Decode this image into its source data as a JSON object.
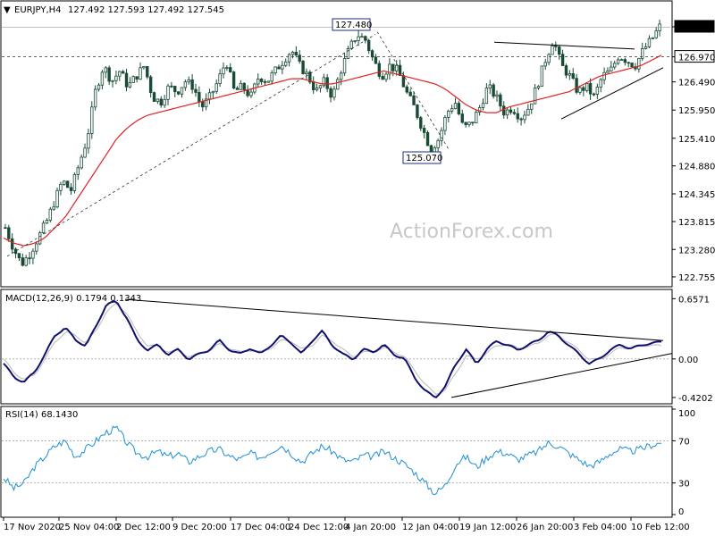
{
  "chart_data": [
    {
      "type": "candlestick",
      "header": {
        "symbol": "EURJPY,H4",
        "values": "127.492 127.593 127.492 127.545"
      },
      "watermark": "ActionForex.com",
      "ylim": [
        122.755,
        127.545
      ],
      "y_ticks": [
        "127.545",
        "126.970",
        "126.490",
        "125.950",
        "125.410",
        "124.880",
        "124.345",
        "123.815",
        "123.280",
        "122.755"
      ],
      "x_ticks": [
        "17 Nov 2020",
        "25 Nov 04:00",
        "2 Dec 12:00",
        "9 Dec 20:00",
        "17 Dec 04:00",
        "24 Dec 12:00",
        "4 Jan 20:00",
        "12 Jan 04:00",
        "19 Jan 12:00",
        "26 Jan 20:00",
        "3 Feb 04:00",
        "10 Feb 12:00"
      ],
      "annotations": [
        {
          "label": "127.480",
          "type": "swing-high"
        },
        {
          "label": "125.070",
          "type": "swing-low"
        }
      ],
      "current_price": "127.545",
      "horizontal_level": "126.970",
      "price_close_path": [
        123.7,
        123.3,
        123.0,
        123.2,
        123.5,
        123.8,
        124.2,
        124.6,
        124.4,
        124.9,
        125.4,
        126.3,
        126.8,
        126.5,
        126.7,
        126.4,
        126.6,
        126.8,
        126.2,
        126.1,
        126.4,
        126.3,
        126.5,
        126.4,
        126.0,
        126.2,
        126.5,
        126.9,
        126.3,
        126.4,
        126.2,
        126.6,
        126.5,
        126.7,
        126.9,
        127.1,
        126.8,
        126.6,
        126.3,
        126.5,
        126.2,
        126.7,
        127.1,
        127.4,
        127.3,
        126.9,
        126.6,
        126.8,
        126.7,
        126.3,
        126.0,
        125.6,
        125.2,
        125.4,
        125.9,
        126.1,
        125.6,
        125.7,
        126.0,
        126.4,
        126.2,
        125.9,
        126.0,
        125.8,
        126.0,
        126.4,
        126.9,
        127.3,
        126.8,
        126.6,
        126.3,
        126.4,
        126.2,
        126.6,
        126.7,
        127.0,
        126.9,
        126.8,
        127.1,
        127.3,
        127.545
      ],
      "ma_path": [
        123.5,
        123.4,
        123.35,
        123.4,
        123.5,
        123.7,
        123.9,
        124.2,
        124.5,
        124.8,
        125.1,
        125.4,
        125.6,
        125.75,
        125.85,
        125.9,
        125.95,
        126.0,
        126.05,
        126.1,
        126.15,
        126.2,
        126.25,
        126.3,
        126.35,
        126.4,
        126.45,
        126.5,
        126.55,
        126.55,
        126.5,
        126.45,
        126.45,
        126.5,
        126.55,
        126.6,
        126.65,
        126.7,
        126.65,
        126.6,
        126.55,
        126.5,
        126.45,
        126.35,
        126.2,
        126.05,
        125.95,
        125.9,
        125.9,
        126.0,
        126.05,
        126.1,
        126.15,
        126.2,
        126.25,
        126.3,
        126.4,
        126.5,
        126.6,
        126.65,
        126.7,
        126.75,
        126.8,
        126.9,
        127.0
      ]
    },
    {
      "type": "line",
      "title": "MACD(12,26,9) 0.1794 0.1343",
      "ylim": [
        -0.4202,
        0.6571
      ],
      "y_ticks": [
        "0.6571",
        "0.00",
        "-0.4202"
      ],
      "macd_path": [
        -0.05,
        -0.2,
        -0.25,
        -0.15,
        0.05,
        0.25,
        0.35,
        0.2,
        0.15,
        0.35,
        0.6,
        0.62,
        0.45,
        0.2,
        0.1,
        0.15,
        0.05,
        0.1,
        0.0,
        0.05,
        0.1,
        0.2,
        0.1,
        0.05,
        0.12,
        0.05,
        0.15,
        0.25,
        0.18,
        0.05,
        0.2,
        0.3,
        0.15,
        0.05,
        0.0,
        0.1,
        0.08,
        0.15,
        0.05,
        0.0,
        -0.2,
        -0.35,
        -0.42,
        -0.3,
        -0.05,
        0.1,
        -0.05,
        0.1,
        0.2,
        0.15,
        0.1,
        0.15,
        0.2,
        0.3,
        0.25,
        0.15,
        0.05,
        -0.05,
        0.0,
        0.1,
        0.15,
        0.12,
        0.14,
        0.18,
        0.1794
      ],
      "signal_path": [
        0.0,
        -0.15,
        -0.22,
        -0.18,
        0.0,
        0.18,
        0.3,
        0.25,
        0.18,
        0.3,
        0.52,
        0.6,
        0.5,
        0.28,
        0.15,
        0.14,
        0.08,
        0.09,
        0.03,
        0.05,
        0.09,
        0.16,
        0.12,
        0.07,
        0.1,
        0.07,
        0.12,
        0.2,
        0.2,
        0.1,
        0.15,
        0.25,
        0.2,
        0.1,
        0.03,
        0.07,
        0.08,
        0.12,
        0.08,
        0.02,
        -0.12,
        -0.28,
        -0.38,
        -0.34,
        -0.15,
        0.03,
        0.0,
        0.06,
        0.15,
        0.16,
        0.12,
        0.13,
        0.17,
        0.26,
        0.26,
        0.18,
        0.09,
        0.0,
        -0.01,
        0.06,
        0.12,
        0.12,
        0.13,
        0.16,
        0.1343
      ]
    },
    {
      "type": "line",
      "title": "RSI(14) 68.1430",
      "ylim": [
        0,
        100
      ],
      "y_ticks": [
        "100",
        "70",
        "30",
        "0"
      ],
      "rsi_path": [
        35,
        25,
        30,
        45,
        55,
        65,
        70,
        55,
        62,
        70,
        78,
        82,
        68,
        58,
        55,
        60,
        55,
        58,
        50,
        55,
        60,
        62,
        55,
        52,
        58,
        54,
        60,
        66,
        58,
        50,
        58,
        65,
        60,
        52,
        50,
        56,
        55,
        60,
        54,
        48,
        40,
        30,
        20,
        28,
        48,
        55,
        45,
        54,
        60,
        58,
        52,
        56,
        60,
        68,
        65,
        58,
        52,
        46,
        50,
        58,
        62,
        60,
        62,
        66,
        68.143
      ]
    }
  ]
}
